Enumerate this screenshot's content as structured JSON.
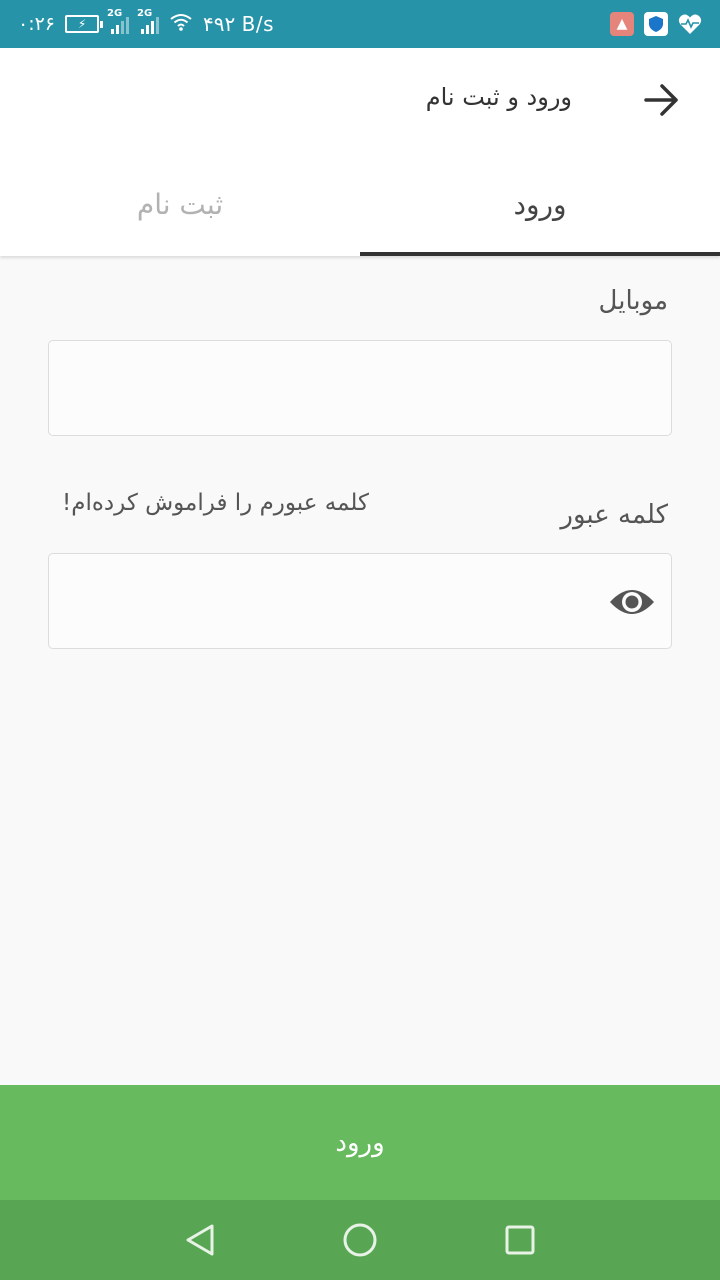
{
  "status_bar": {
    "time": "۰:۲۶",
    "network_1": "2G",
    "network_2": "2G",
    "speed": "۴۹۲ B/s",
    "icons": [
      "battery-charging-icon",
      "signal-icon",
      "wifi-icon",
      "rocket-app-icon",
      "shield-app-icon",
      "heart-monitor-icon"
    ]
  },
  "header": {
    "title": "ورود و ثبت نام",
    "back_icon": "arrow-right-icon"
  },
  "tabs": [
    {
      "label": "ورود",
      "active": true
    },
    {
      "label": "ثبت نام",
      "active": false
    }
  ],
  "form": {
    "mobile_label": "موبایل",
    "mobile_value": "",
    "password_label": "کلمه عبور",
    "password_value": "",
    "forgot_link": "کلمه عبورم را فراموش کرده‌ام!",
    "show_password_icon": "eye-icon"
  },
  "submit_label": "ورود",
  "nav": {
    "icons": [
      "back-triangle-icon",
      "home-circle-icon",
      "recents-square-icon"
    ]
  },
  "colors": {
    "status_bar": "#2693a8",
    "primary_green": "#67ba5d",
    "nav_green": "#58a653",
    "tab_indicator": "#333333"
  }
}
